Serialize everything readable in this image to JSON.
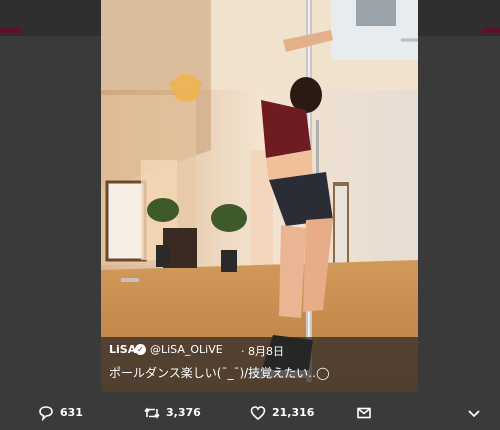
{
  "tweet": {
    "display_name": "LiSA",
    "verified_glyph": "✓",
    "handle": "@LiSA_OLiVE",
    "separator": "·",
    "date": "8月8日",
    "text": "ポールダンス楽しい(¯_¯)/技覚えたい‥◯"
  },
  "actions": {
    "reply_count": "631",
    "retweet_count": "3,376",
    "like_count": "21,316"
  },
  "icons": {
    "reply": "speech-bubble-icon",
    "retweet": "retweet-arrows-icon",
    "like": "heart-outline-icon",
    "dm": "envelope-icon",
    "more": "chevron-down-icon"
  },
  "colors": {
    "background": "#3a3a3a",
    "accent": "#5c1225",
    "text": "#ffffff"
  }
}
